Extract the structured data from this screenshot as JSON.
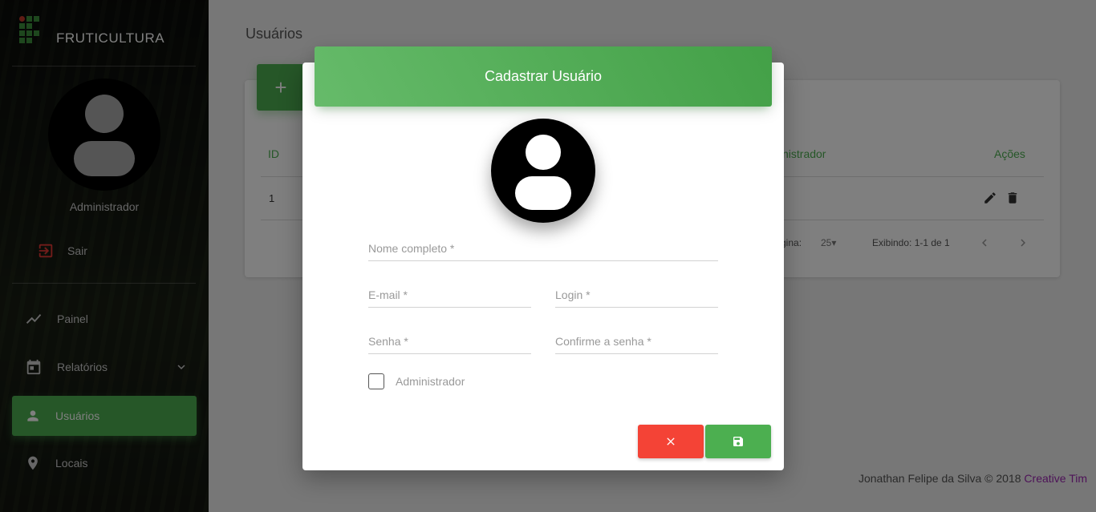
{
  "sidebar": {
    "brand": "FRUTICULTURA",
    "user_role": "Administrador",
    "logout_label": "Sair",
    "items": [
      {
        "label": "Painel"
      },
      {
        "label": "Relatórios"
      },
      {
        "label": "Usuários"
      },
      {
        "label": "Locais"
      }
    ]
  },
  "main": {
    "page_title": "Usuários",
    "add_label": "+",
    "table": {
      "headers": [
        "ID",
        "nistrador",
        "Ações"
      ],
      "rows": [
        [
          "1"
        ]
      ]
    },
    "pager": {
      "per_page_label": "gina:",
      "per_page_value": "25",
      "showing": "Exibindo: 1-1 de 1"
    }
  },
  "footer": {
    "text": "Jonathan Felipe da Silva © 2018",
    "link": "Creative Tim"
  },
  "dialog": {
    "title": "Cadastrar Usuário",
    "fields": {
      "full_name": "Nome completo *",
      "email": "E-mail *",
      "login": "Login *",
      "password": "Senha *",
      "confirm_password": "Confirme a senha *"
    },
    "admin_label": "Administrador"
  },
  "colors": {
    "primary": "#4caf50",
    "danger": "#f44336",
    "link": "#9c27b0"
  }
}
